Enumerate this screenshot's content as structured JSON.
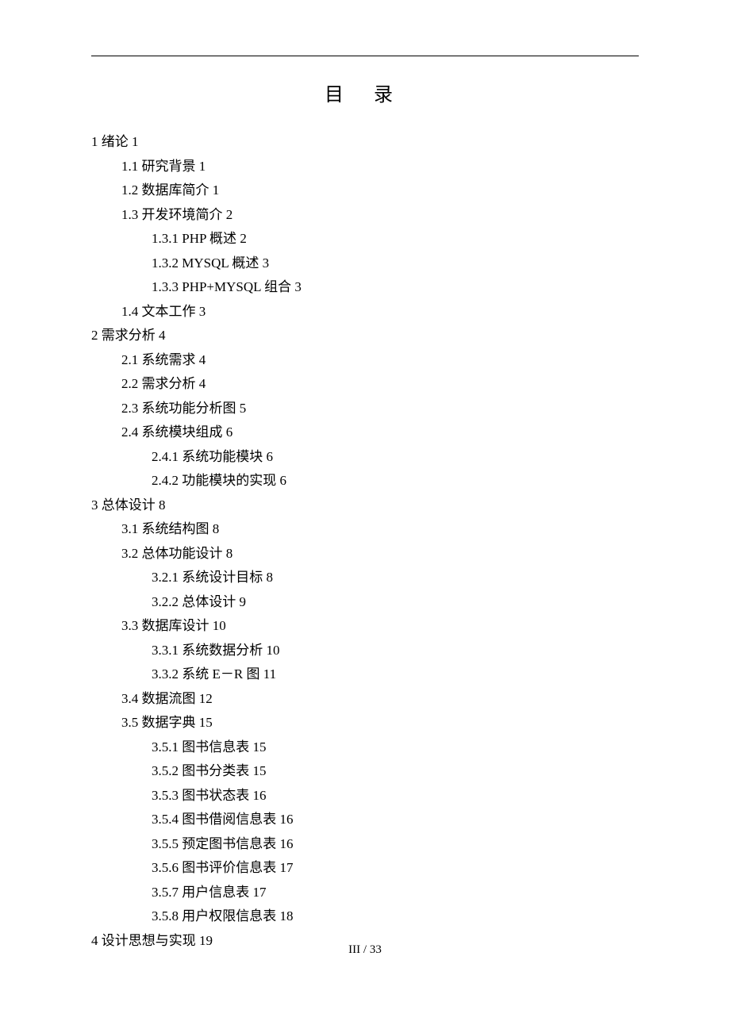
{
  "title": "目  录",
  "footer": "III / 33",
  "toc": [
    {
      "indent": 1,
      "num": "1",
      "label": "绪论",
      "pg": "1"
    },
    {
      "indent": 2,
      "num": "1.1",
      "label": "研究背景",
      "pg": "1"
    },
    {
      "indent": 2,
      "num": "1.2",
      "label": "数据库简介",
      "pg": "1"
    },
    {
      "indent": 2,
      "num": "1.3",
      "label": "开发环境简介",
      "pg": "2"
    },
    {
      "indent": 3,
      "num": "1.3.1",
      "label": "PHP 概述",
      "pg": "2"
    },
    {
      "indent": 3,
      "num": "1.3.2",
      "label": "MYSQL 概述",
      "pg": "3"
    },
    {
      "indent": 3,
      "num": "1.3.3",
      "label": "PHP+MYSQL 组合",
      "pg": "3"
    },
    {
      "indent": 2,
      "num": "1.4",
      "label": "文本工作",
      "pg": "3"
    },
    {
      "indent": 1,
      "num": "2",
      "label": "需求分析",
      "pg": "4"
    },
    {
      "indent": 2,
      "num": "2.1",
      "label": "系统需求",
      "pg": "4"
    },
    {
      "indent": 2,
      "num": "2.2",
      "label": "需求分析",
      "pg": "4"
    },
    {
      "indent": 2,
      "num": "2.3",
      "label": "系统功能分析图",
      "pg": "5"
    },
    {
      "indent": 2,
      "num": "2.4",
      "label": "系统模块组成",
      "pg": "6"
    },
    {
      "indent": 3,
      "num": "2.4.1",
      "label": "系统功能模块",
      "pg": "6"
    },
    {
      "indent": 3,
      "num": "2.4.2",
      "label": "功能模块的实现",
      "pg": "6"
    },
    {
      "indent": 1,
      "num": "3",
      "label": "总体设计",
      "pg": "8"
    },
    {
      "indent": 2,
      "num": "3.1",
      "label": "系统结构图",
      "pg": "8"
    },
    {
      "indent": 2,
      "num": "3.2",
      "label": "总体功能设计",
      "pg": "8"
    },
    {
      "indent": 3,
      "num": "3.2.1",
      "label": "系统设计目标",
      "pg": "8"
    },
    {
      "indent": 3,
      "num": "3.2.2",
      "label": "总体设计",
      "pg": "9"
    },
    {
      "indent": 2,
      "num": "3.3",
      "label": "数据库设计",
      "pg": "10"
    },
    {
      "indent": 3,
      "num": "3.3.1",
      "label": "系统数据分析",
      "pg": "10"
    },
    {
      "indent": 3,
      "num": "3.3.2",
      "label": "系统 E－R 图",
      "pg": "11"
    },
    {
      "indent": 2,
      "num": "3.4",
      "label": "数据流图",
      "pg": "12"
    },
    {
      "indent": 2,
      "num": "3.5",
      "label": "数据字典",
      "pg": "15"
    },
    {
      "indent": 3,
      "num": "3.5.1",
      "label": "图书信息表",
      "pg": "15"
    },
    {
      "indent": 3,
      "num": "3.5.2",
      "label": "图书分类表",
      "pg": "15"
    },
    {
      "indent": 3,
      "num": "3.5.3",
      "label": "图书状态表",
      "pg": "16"
    },
    {
      "indent": 3,
      "num": "3.5.4",
      "label": "图书借阅信息表",
      "pg": "16"
    },
    {
      "indent": 3,
      "num": "3.5.5",
      "label": "预定图书信息表",
      "pg": "16"
    },
    {
      "indent": 3,
      "num": "3.5.6",
      "label": "图书评价信息表",
      "pg": "17"
    },
    {
      "indent": 3,
      "num": "3.5.7",
      "label": "用户信息表",
      "pg": "17"
    },
    {
      "indent": 3,
      "num": "3.5.8",
      "label": "用户权限信息表",
      "pg": "18"
    },
    {
      "indent": 1,
      "num": "4",
      "label": "设计思想与实现",
      "pg": "19"
    }
  ]
}
